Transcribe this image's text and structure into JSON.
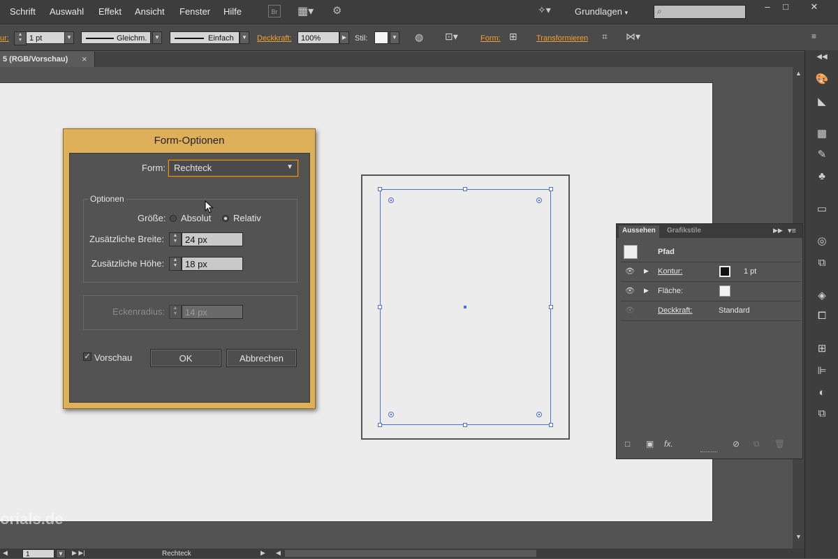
{
  "menu": {
    "items": [
      "Schrift",
      "Auswahl",
      "Effekt",
      "Ansicht",
      "Fenster",
      "Hilfe"
    ],
    "bridge_label": "Br",
    "workspace": "Grundlagen",
    "window_controls": [
      "–",
      "□",
      "✕"
    ]
  },
  "control_bar": {
    "stroke_label": "ur:",
    "stroke_weight": "1 pt",
    "stroke_profile": "Gleichm.",
    "brush": "Einfach",
    "opacity_label": "Deckkraft:",
    "opacity_value": "100%",
    "style_label": "Stil:",
    "shape_label": "Form:",
    "transform_label": "Transformieren"
  },
  "document_tab": {
    "title": "5 (RGB/Vorschau)",
    "close": "×"
  },
  "dialog": {
    "title": "Form-Optionen",
    "shape_label": "Form:",
    "shape_value": "Rechteck",
    "options_group": "Optionen",
    "size_label": "Größe:",
    "size_absolute": "Absolut",
    "size_relative": "Relativ",
    "size_selected": "Relativ",
    "extra_width_label": "Zusätzliche Breite:",
    "extra_width_value": "24 px",
    "extra_height_label": "Zusätzliche Höhe:",
    "extra_height_value": "18 px",
    "corner_radius_label": "Eckenradius:",
    "corner_radius_value": "14 px",
    "preview_label": "Vorschau",
    "preview_checked": true,
    "ok_label": "OK",
    "cancel_label": "Abbrechen"
  },
  "appearance_panel": {
    "tab_active": "Aussehen",
    "tab_inactive": "Grafikstile",
    "object": "Pfad",
    "rows": [
      {
        "label": "Kontur:",
        "value": "1 pt"
      },
      {
        "label": "Fläche:",
        "value": ""
      },
      {
        "label": "Deckkraft:",
        "value": "Standard"
      }
    ],
    "footer_fx": "fx."
  },
  "status_bar": {
    "zoom_value": "1",
    "tool_name": "Rechteck"
  },
  "watermark": "orials.de",
  "colors": {
    "selection": "#4a6fe0",
    "accent_orange": "#f0a030",
    "dialog_frame": "#dfb05a"
  }
}
